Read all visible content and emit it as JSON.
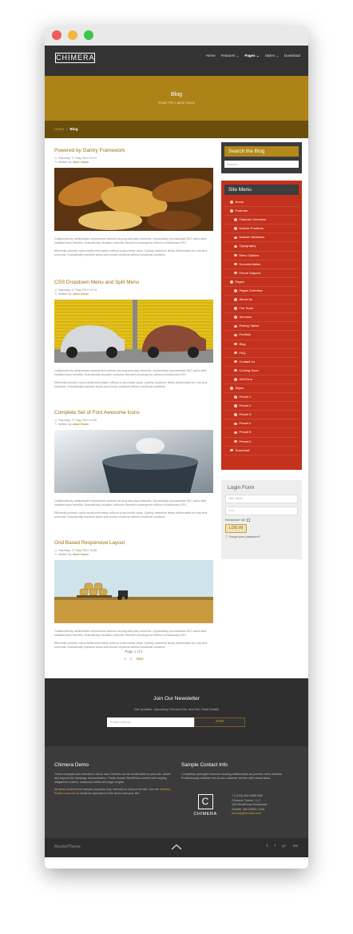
{
  "site": {
    "logo": "CHIMERA"
  },
  "nav": {
    "items": [
      {
        "label": "Home"
      },
      {
        "label": "Features ⌄"
      },
      {
        "label": "Pages ⌄"
      },
      {
        "label": "Styles ⌄"
      },
      {
        "label": "Download"
      }
    ],
    "active_index": 2
  },
  "hero": {
    "title": "Blog",
    "subtitle": "Read The Latest News"
  },
  "breadcrumb": {
    "home": "Home",
    "separator": "›",
    "current": "Blog"
  },
  "posts": [
    {
      "title": "Powered by Gantry Framework",
      "date": "Saturday, 17 May 2014 10:41",
      "author_prefix": "Written by",
      "author": "Jakub Baran",
      "paragraphs": [
        "Collaboratively administrate empowered markets via plug-and-play networks. Dynamically procrastinate B2C users after installed base benefits. Dramatically visualize customer directed convergence without revolutionary ROI.",
        "Efficiently unleash cross-media information without cross-media value. Quickly maximize timely deliverables for real-time schemas. Dramatically maintain clicks-and-mortar solutions without functional solutions."
      ]
    },
    {
      "title": "CSS Dropdown Menu and Split Menu",
      "date": "Saturday, 17 May 2014 10:14",
      "author_prefix": "Written by",
      "author": "Jakub Baran",
      "paragraphs": [
        "Collaboratively administrate empowered markets via plug-and-play networks. Dynamically procrastinate B2C users after installed base benefits. Dramatically visualize customer directed convergence without revolutionary ROI.",
        "Efficiently unleash cross-media information without cross-media value. Quickly maximize timely deliverables for real-time schemas. Dramatically maintain clicks-and-mortar solutions without functional solutions."
      ]
    },
    {
      "title": "Complete Set of Font Awesome Icons",
      "date": "Saturday, 17 May 2014 10:00",
      "author_prefix": "Written by",
      "author": "Jakub Baran",
      "paragraphs": [
        "Collaboratively administrate empowered markets via plug-and-play networks. Dynamically procrastinate B2C users after installed base benefits. Dramatically visualize customer directed convergence without revolutionary ROI.",
        "Efficiently unleash cross-media information without cross-media value. Quickly maximize timely deliverables for real-time schemas. Dramatically maintain clicks-and-mortar solutions without functional solutions."
      ]
    },
    {
      "title": "Grid Based Responsive Layout",
      "date": "Saturday, 17 May 2014 10:58",
      "author_prefix": "Written by",
      "author": "Jakub Baran",
      "paragraphs": [
        "Collaboratively administrate empowered markets via plug-and-play networks. Dynamically procrastinate B2C users after installed base benefits. Dramatically visualize customer directed convergence without revolutionary ROI.",
        "Efficiently unleash cross-media information without cross-media value. Quickly maximize timely deliverables for real-time schemas. Dramatically maintain clicks-and-mortar solutions without functional solutions."
      ]
    }
  ],
  "pagination": {
    "info": "Page 1 of 2",
    "pages": [
      "1",
      "2"
    ],
    "next": "Next"
  },
  "search": {
    "title": "Search the Blog",
    "placeholder": "Search..."
  },
  "site_menu": {
    "title": "Site Menu",
    "items": [
      {
        "label": "Home",
        "level": 0
      },
      {
        "label": "Features",
        "level": 0
      },
      {
        "label": "Features Overview",
        "level": 1
      },
      {
        "label": "Module Positions",
        "level": 1
      },
      {
        "label": "Module Variations",
        "level": 1
      },
      {
        "label": "Typography",
        "level": 1
      },
      {
        "label": "Menu Options",
        "level": 1
      },
      {
        "label": "Documentation",
        "level": 1
      },
      {
        "label": "Forum Support",
        "level": 1
      },
      {
        "label": "Pages",
        "level": 0
      },
      {
        "label": "Pages Overview",
        "level": 1
      },
      {
        "label": "About Us",
        "level": 1
      },
      {
        "label": "The Team",
        "level": 1
      },
      {
        "label": "Services",
        "level": 1
      },
      {
        "label": "Pricing Tables",
        "level": 1
      },
      {
        "label": "Portfolio",
        "level": 1
      },
      {
        "label": "Blog",
        "level": 1
      },
      {
        "label": "FAQ",
        "level": 1
      },
      {
        "label": "Contact Us",
        "level": 1
      },
      {
        "label": "Coming Soon",
        "level": 1
      },
      {
        "label": "404 Error",
        "level": 1
      },
      {
        "label": "Styles",
        "level": 0
      },
      {
        "label": "Preset 1",
        "level": 1
      },
      {
        "label": "Preset 2",
        "level": 1
      },
      {
        "label": "Preset 3",
        "level": 1
      },
      {
        "label": "Preset 4",
        "level": 1
      },
      {
        "label": "Preset 5",
        "level": 1
      },
      {
        "label": "Preset 6",
        "level": 1
      },
      {
        "label": "Download",
        "level": 0
      }
    ]
  },
  "login": {
    "title": "Login Form",
    "username_placeholder": "User Name",
    "password_placeholder": "••••••",
    "remember": "Remember Me",
    "button": "LOG IN",
    "forgot": "Forgot your password?"
  },
  "newsletter": {
    "title": "Join Our Newsletter",
    "subtitle": "Get Updates, Upcoming Themes Info, and Our Great Deals!",
    "placeholder": "Email Address",
    "button": "JOIN"
  },
  "footer": {
    "demo_title": "Chimera Demo",
    "demo_p1": "These examples are intended to show how Chimera can be constructed on your site, above and beyond the frontpage demonstration. These include WordPress content with varying widgetized content, mainbody widths and page lengths.",
    "demo_p2_before": "All demo content is for sample purposes only, intended to show a live site. Use the",
    "demo_p2_link": "Chimera Rocket Launcher",
    "demo_p2_after": "to install an equivalent of the demo onto your site.",
    "contact_title": "Sample Contact Info",
    "contact_p": "Completely synergize resource sucking relationships via premier niche markets. Professionally cultivate one-to-one customer service with robust ideas.",
    "contact_logo_letter": "C",
    "contact_logo_name": "CHIMERA",
    "contact_lines": [
      "+1 (123) 456-5555 555",
      "Chimera Theme, LLC",
      "123 WordPress Boulevard",
      "Seattle, WA 00000, USA"
    ],
    "contact_email": "noreply@domain.com"
  },
  "bottom": {
    "brand": "RocketTheme",
    "socials": [
      "𝕥",
      "f",
      "g+",
      "rss"
    ]
  },
  "colors": {
    "accent": "#ad8317",
    "menu_red": "#c4311c",
    "dark": "#333333"
  }
}
